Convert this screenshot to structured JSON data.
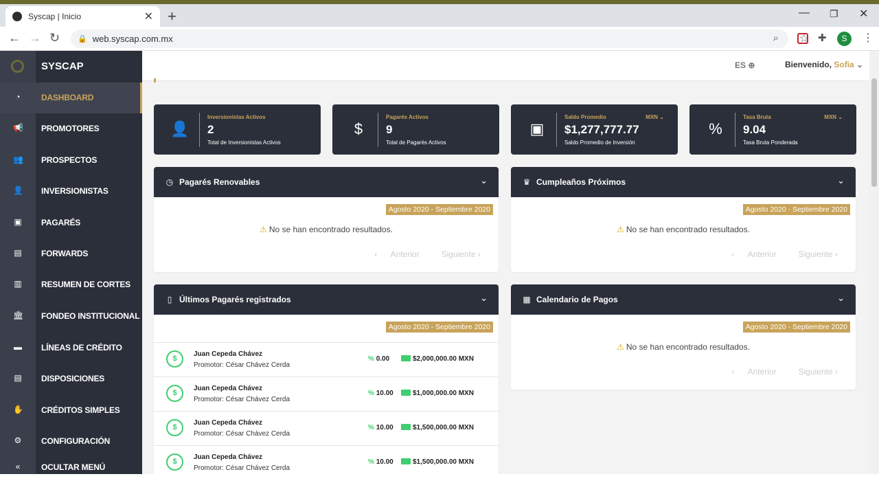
{
  "browser": {
    "tab_title": "Syscap | Inicio",
    "tab_close": "✕",
    "new_tab": "+",
    "url": "web.syscap.com.mx",
    "profile_initial": "S",
    "minimize": "—",
    "maximize": "❐",
    "close": "✕"
  },
  "sidebar": {
    "brand": "SYSCAP",
    "items": [
      {
        "label": "DASHBOARD",
        "icon": "gauge-icon",
        "glyph": "◔",
        "active": true
      },
      {
        "label": "PROMOTORES",
        "icon": "megaphone-icon",
        "glyph": "📢"
      },
      {
        "label": "PROSPECTOS",
        "icon": "users-icon",
        "glyph": "👥"
      },
      {
        "label": "INVERSIONISTAS",
        "icon": "user-tie-icon",
        "glyph": "👤"
      },
      {
        "label": "PAGARÉS",
        "icon": "money-bill-icon",
        "glyph": "▣"
      },
      {
        "label": "FORWARDS",
        "icon": "id-card-icon",
        "glyph": "▤"
      },
      {
        "label": "RESUMEN DE CORTES",
        "icon": "chart-bar-icon",
        "glyph": "▥"
      },
      {
        "label": "FONDEO INSTITUCIONAL",
        "icon": "bank-icon",
        "glyph": "🏛"
      },
      {
        "label": "LÍNEAS DE CRÉDITO",
        "icon": "credit-card-icon",
        "glyph": "▬"
      },
      {
        "label": "DISPOSICIONES",
        "icon": "id-badge-icon",
        "glyph": "▤"
      },
      {
        "label": "CRÉDITOS SIMPLES",
        "icon": "hand-holding-usd-icon",
        "glyph": "✋"
      },
      {
        "label": "CONFIGURACIÓN",
        "icon": "gear-icon",
        "glyph": "⚙"
      },
      {
        "label": "OCULTAR MENÚ",
        "icon": "double-chevron-left-icon",
        "glyph": "«"
      }
    ]
  },
  "topnav": {
    "lang": "ES",
    "welcome": "Bienvenido,",
    "user": "Sofia"
  },
  "cards": [
    {
      "title": "Inversionistas Activos",
      "value": "2",
      "sub": "Total de Inversionistas Activos",
      "icon": "user-check-icon",
      "glyph": "👤",
      "currency": ""
    },
    {
      "title": "Pagarés Activos",
      "value": "9",
      "sub": "Total de Pagarés Activos",
      "icon": "file-invoice-dollar-icon",
      "glyph": "$",
      "currency": ""
    },
    {
      "title": "Saldo Promedio",
      "value": "$1,277,777.77",
      "sub": "Saldo Promedio de Inversión",
      "icon": "money-bill-icon",
      "glyph": "▣",
      "currency": "MXN"
    },
    {
      "title": "Tasa Bruta",
      "value": "9.04",
      "sub": "Tasa Bruta Ponderada",
      "icon": "percent-icon",
      "glyph": "%",
      "currency": "MXN"
    }
  ],
  "panels": {
    "renovables": {
      "title": "Pagarés Renovables",
      "range": "Agosto 2020 - Septiembre 2020",
      "empty": "No se han encontrado resultados.",
      "prev": "Anterior",
      "next": "Siguiente"
    },
    "cumpleanos": {
      "title": "Cumpleaños Próximos",
      "range": "Agosto 2020 - Septiembre 2020",
      "empty": "No se han encontrado resultados.",
      "prev": "Anterior",
      "next": "Siguiente"
    },
    "ultimos": {
      "title": "Últimos Pagarés registrados",
      "range": "Agosto 2020 - Septiembre 2020"
    },
    "calendario": {
      "title": "Calendario de Pagos",
      "range": "Agosto 2020 - Septiembre 2020",
      "empty": "No se han encontrado resultados.",
      "prev": "Anterior",
      "next": "Siguiente"
    }
  },
  "pagares": [
    {
      "name": "Juan Cepeda Chávez",
      "promotor": "Promotor: César Chávez Cerda",
      "rate": "0.00",
      "amount": "$2,000,000.00 MXN"
    },
    {
      "name": "Juan Cepeda Chávez",
      "promotor": "Promotor: César Chávez Cerda",
      "rate": "10.00",
      "amount": "$1,000,000.00 MXN"
    },
    {
      "name": "Juan Cepeda Chávez",
      "promotor": "Promotor: César Chávez Cerda",
      "rate": "10.00",
      "amount": "$1,500,000.00 MXN"
    },
    {
      "name": "Juan Cepeda Chávez",
      "promotor": "Promotor: César Chávez Cerda",
      "rate": "10.00",
      "amount": "$1,500,000.00 MXN"
    }
  ],
  "colors": {
    "accent": "#c8a35a",
    "dark": "#2a2f3a",
    "green": "#3ecf6e"
  }
}
